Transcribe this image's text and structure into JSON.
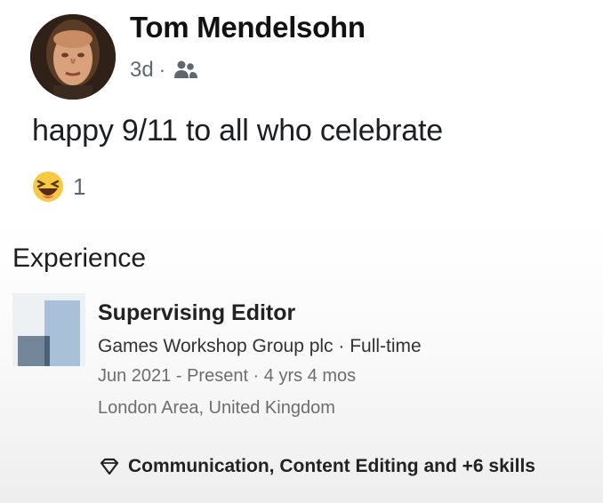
{
  "post": {
    "author": "Tom Mendelsohn",
    "time": "3d",
    "separator": "·",
    "audience_icon": "friends-icon",
    "text": "happy 9/11 to all who celebrate",
    "reaction_icon": "haha-icon",
    "reaction_count": "1"
  },
  "experience": {
    "heading": "Experience",
    "company_logo_icon": "company-logo",
    "title": "Supervising Editor",
    "company_line": "Games Workshop Group plc · Full-time",
    "dates_line": "Jun 2021 - Present · 4 yrs 4 mos",
    "location_line": "London Area, United Kingdom",
    "skills_icon": "diamond-icon",
    "skills": "Communication, Content Editing and +6 skills"
  },
  "colors": {
    "author": "#111111",
    "meta": "#606770",
    "text": "#1c1e21",
    "muted": "#6d6d6d",
    "logo_light": "#a8c1d8",
    "logo_dark": "#6c7f95"
  }
}
